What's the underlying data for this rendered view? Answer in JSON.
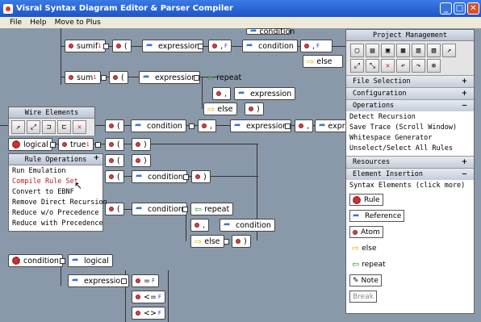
{
  "window": {
    "title": "Visral Syntax Diagram Editor & Parser Compiler",
    "min": "_",
    "max": "□",
    "close": "✕"
  },
  "menu": [
    "File",
    "Help",
    "Move to Plus"
  ],
  "diagram": {
    "sumif": "sumif",
    "sumif_sub": "1",
    "sum": "sum",
    "sum_sub": "1",
    "comma": ",",
    "paren_open": "(",
    "paren_close": ")",
    "expression": "expression",
    "condition": "condition",
    "repeat": "repeat",
    "else": "else",
    "logical": "logical",
    "true": "true",
    "true_sub": "1",
    "F": "F",
    "eq": "=",
    "lte": "<=",
    "neq": "<>",
    "expr_cut": "expre"
  },
  "wire_panel": {
    "title": "Wire Elements"
  },
  "rule_ops": {
    "title": "Rule Operations",
    "toggle": "+",
    "items": [
      "Run Emulation",
      "Compile Rule Set",
      "Convert to EBNF",
      "Remove Direct Recursion",
      "Reduce w/o Precedence",
      "Reduce with Precedence"
    ]
  },
  "project": {
    "title": "Project Management",
    "sections": [
      {
        "label": "File Selection",
        "toggle": "+"
      },
      {
        "label": "Configuration",
        "toggle": "+"
      },
      {
        "label": "Operations",
        "toggle": "−"
      }
    ],
    "operations": [
      "Detect Recursion",
      "Save Trace (Scroll Window)",
      "Whitespace Generator",
      "Unselect/Select All Rules"
    ],
    "resources": {
      "label": "Resources",
      "toggle": "+"
    },
    "insertion": {
      "label": "Element Insertion",
      "toggle": "−"
    },
    "syntax_label": "Syntax Elements (click more)",
    "elements": [
      "Rule",
      "Reference",
      "Atom",
      "else",
      "repeat",
      "Note",
      "Break"
    ]
  }
}
